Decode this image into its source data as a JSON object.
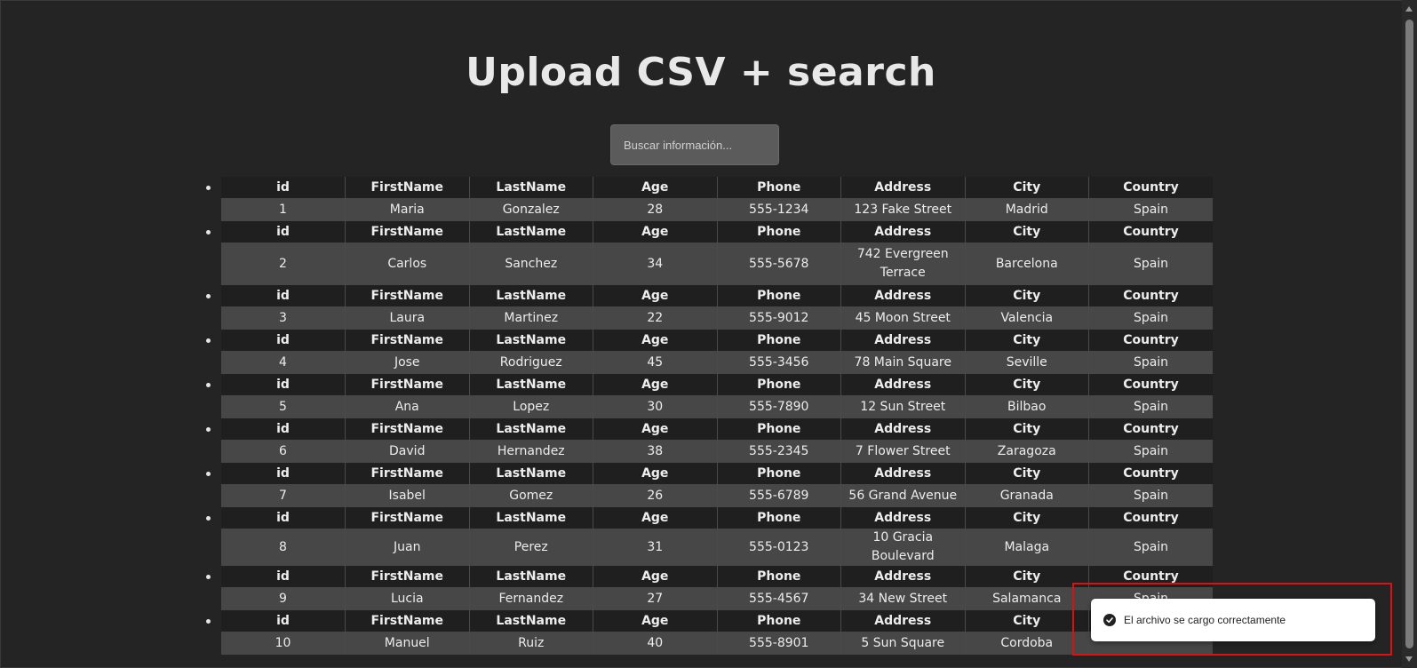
{
  "title": "Upload CSV + search",
  "search": {
    "placeholder": "Buscar información..."
  },
  "columns": [
    "id",
    "FirstName",
    "LastName",
    "Age",
    "Phone",
    "Address",
    "City",
    "Country"
  ],
  "records": [
    [
      "1",
      "Maria",
      "Gonzalez",
      "28",
      "555-1234",
      "123 Fake Street",
      "Madrid",
      "Spain"
    ],
    [
      "2",
      "Carlos",
      "Sanchez",
      "34",
      "555-5678",
      "742 Evergreen Terrace",
      "Barcelona",
      "Spain"
    ],
    [
      "3",
      "Laura",
      "Martinez",
      "22",
      "555-9012",
      "45 Moon Street",
      "Valencia",
      "Spain"
    ],
    [
      "4",
      "Jose",
      "Rodriguez",
      "45",
      "555-3456",
      "78 Main Square",
      "Seville",
      "Spain"
    ],
    [
      "5",
      "Ana",
      "Lopez",
      "30",
      "555-7890",
      "12 Sun Street",
      "Bilbao",
      "Spain"
    ],
    [
      "6",
      "David",
      "Hernandez",
      "38",
      "555-2345",
      "7 Flower Street",
      "Zaragoza",
      "Spain"
    ],
    [
      "7",
      "Isabel",
      "Gomez",
      "26",
      "555-6789",
      "56 Grand Avenue",
      "Granada",
      "Spain"
    ],
    [
      "8",
      "Juan",
      "Perez",
      "31",
      "555-0123",
      "10 Gracia Boulevard",
      "Malaga",
      "Spain"
    ],
    [
      "9",
      "Lucia",
      "Fernandez",
      "27",
      "555-4567",
      "34 New Street",
      "Salamanca",
      "Spain"
    ],
    [
      "10",
      "Manuel",
      "Ruiz",
      "40",
      "555-8901",
      "5 Sun Square",
      "Cordoba",
      ""
    ]
  ],
  "toast": {
    "message": "El archivo se cargo correctamente",
    "icon": "check-circle-icon"
  },
  "colors": {
    "background": "#242424",
    "header_row": "#1f1f1f",
    "data_row": "#474747",
    "highlight": "#dd1111"
  }
}
